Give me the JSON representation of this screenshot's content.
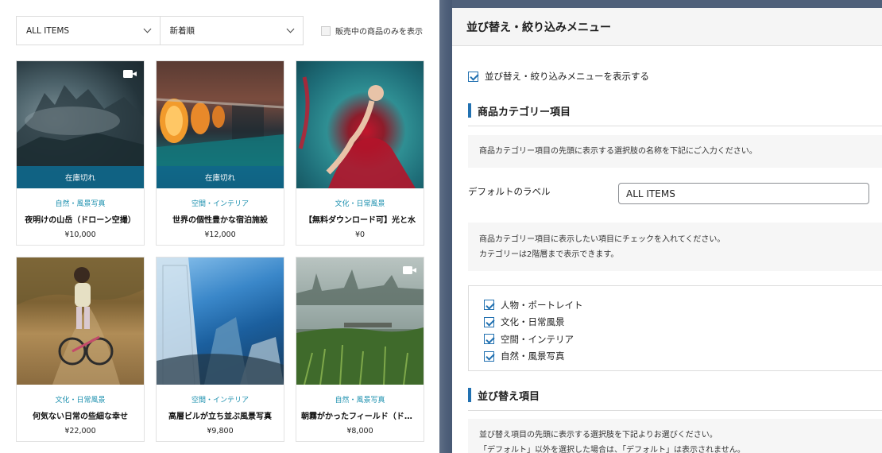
{
  "store": {
    "category_select": "ALL ITEMS",
    "sort_select": "新着順",
    "instock_label": "販売中の商品のみを表示",
    "products": [
      {
        "category": "自然・風景写真",
        "title": "夜明けの山岳（ドローン空撮）",
        "price": "¥10,000",
        "sold_out": "在庫切れ",
        "video": true
      },
      {
        "category": "空間・インテリア",
        "title": "世界の個性豊かな宿泊施設",
        "price": "¥12,000",
        "sold_out": "在庫切れ",
        "video": false
      },
      {
        "category": "文化・日常風景",
        "title": "【無料ダウンロード可】光と水",
        "price": "¥0",
        "sold_out": "",
        "video": false
      },
      {
        "category": "文化・日常風景",
        "title": "何気ない日常の些細な幸せ",
        "price": "¥22,000",
        "sold_out": "",
        "video": false
      },
      {
        "category": "空間・インテリア",
        "title": "高層ビルが立ち並ぶ風景写真",
        "price": "¥9,800",
        "sold_out": "",
        "video": false
      },
      {
        "category": "自然・風景写真",
        "title": "朝霧がかったフィールド（ドローン）",
        "price": "¥8,000",
        "sold_out": "",
        "video": true
      }
    ]
  },
  "settings": {
    "panel_title": "並び替え・絞り込みメニュー",
    "show_menu_label": "並び替え・絞り込みメニューを表示する",
    "category_section_title": "商品カテゴリー項目",
    "category_note": "商品カテゴリー項目の先頭に表示する選択肢の名称を下記にご入力ください。",
    "default_label_caption": "デフォルトのラベル",
    "default_label_value": "ALL ITEMS",
    "check_note_1": "商品カテゴリー項目に表示したい項目にチェックを入れてください。",
    "check_note_2": "カテゴリーは2階層まで表示できます。",
    "categories": [
      "人物・ポートレイト",
      "文化・日常風景",
      "空間・インテリア",
      "自然・風景写真"
    ],
    "sort_section_title": "並び替え項目",
    "sort_note_1": "並び替え項目の先頭に表示する選択肢を下記よりお選びください。",
    "sort_note_2": "「デフォルト」以外を選択した場合は、「デフォルト」は表示されません。"
  },
  "icons": {
    "video": "video-camera-icon",
    "dropdown": "chevron-down-icon",
    "check": "checkbox-checked-icon"
  },
  "colors": {
    "accent": "#2271b1",
    "category_text": "#1a8fae",
    "sold_out_overlay": "#10688c"
  }
}
